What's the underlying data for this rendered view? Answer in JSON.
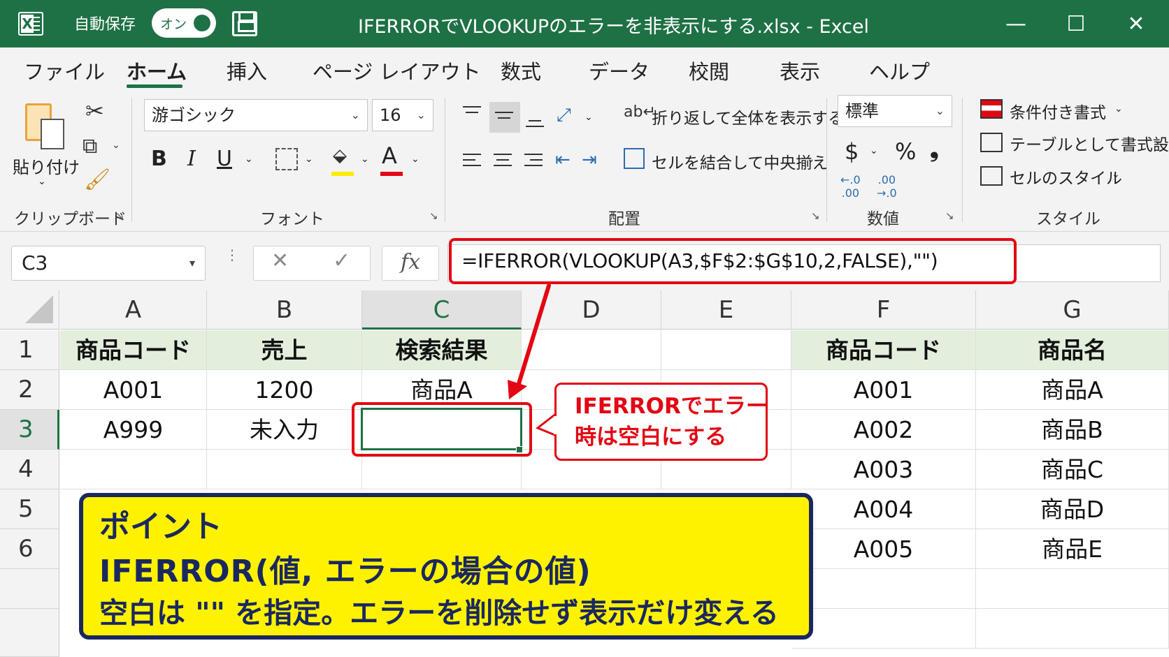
{
  "window": {
    "autosave_label": "自動保存",
    "autosave_state": "オン",
    "title": "IFERRORでVLOOKUPのエラーを非表示にする.xlsx  -  Excel",
    "minimize": "—",
    "maximize": "☐",
    "close": "✕"
  },
  "tabs": [
    "ファイル",
    "ホーム",
    "挿入",
    "ページ レイアウト",
    "数式",
    "データ",
    "校閲",
    "表示",
    "ヘルプ"
  ],
  "active_tab": "ホーム",
  "ribbon": {
    "clipboard": {
      "paste_label": "貼り付け",
      "group_label": "クリップボード"
    },
    "font": {
      "font_name": "游ゴシック",
      "font_size": "16",
      "bold": "B",
      "italic": "I",
      "underline": "U",
      "font_color_glyph": "A",
      "group_label": "フォント"
    },
    "alignment": {
      "wrap_text": "折り返して全体を表示する",
      "merge_center": "セルを結合して中央揃え",
      "group_label": "配置"
    },
    "number": {
      "format": "標準",
      "currency": "$",
      "percent": "%",
      "comma": "❟",
      "group_label": "数値"
    },
    "styles": {
      "conditional": "条件付き書式",
      "as_table": "テーブルとして書式設定",
      "cell_styles": "セルのスタイル",
      "group_label": "スタイル"
    }
  },
  "formula_bar": {
    "name_box": "C3",
    "cancel": "✕",
    "enter": "✓",
    "fx": "fx",
    "formula": "=IFERROR(VLOOKUP(A3,$F$2:$G$10,2,FALSE),\"\")"
  },
  "columns": [
    "A",
    "B",
    "C",
    "D",
    "E",
    "F",
    "G"
  ],
  "selected_column": "C",
  "rows": [
    "1",
    "2",
    "3",
    "4",
    "5",
    "6"
  ],
  "selected_row": "3",
  "cells": {
    "A1": "商品コード",
    "B1": "売上",
    "C1": "検索結果",
    "F1": "商品コード",
    "G1": "商品名",
    "A2": "A001",
    "B2": "1200",
    "C2": "商品A",
    "F2": "A001",
    "G2": "商品A",
    "A3": "A999",
    "B3": "未入力",
    "C3": "",
    "F3": "A002",
    "G3": "商品B",
    "F4": "A003",
    "G4": "商品C",
    "F5": "A004",
    "G5": "商品D",
    "F6": "A005",
    "G6": "商品E"
  },
  "callout": {
    "line1": "IFERRORでエラー",
    "line2": "時は空白にする"
  },
  "point": {
    "title": "ポイント",
    "line1": "IFERROR(値, エラーの場合の値)",
    "line2": "空白は \"\" を指定。エラーを削除せず表示だけ変える"
  },
  "colors": {
    "excel_green": "#1e7145",
    "highlight_red": "#e30613",
    "point_yellow": "#fff200",
    "point_navy": "#1a2860",
    "header_fill": "#e3efdc"
  }
}
